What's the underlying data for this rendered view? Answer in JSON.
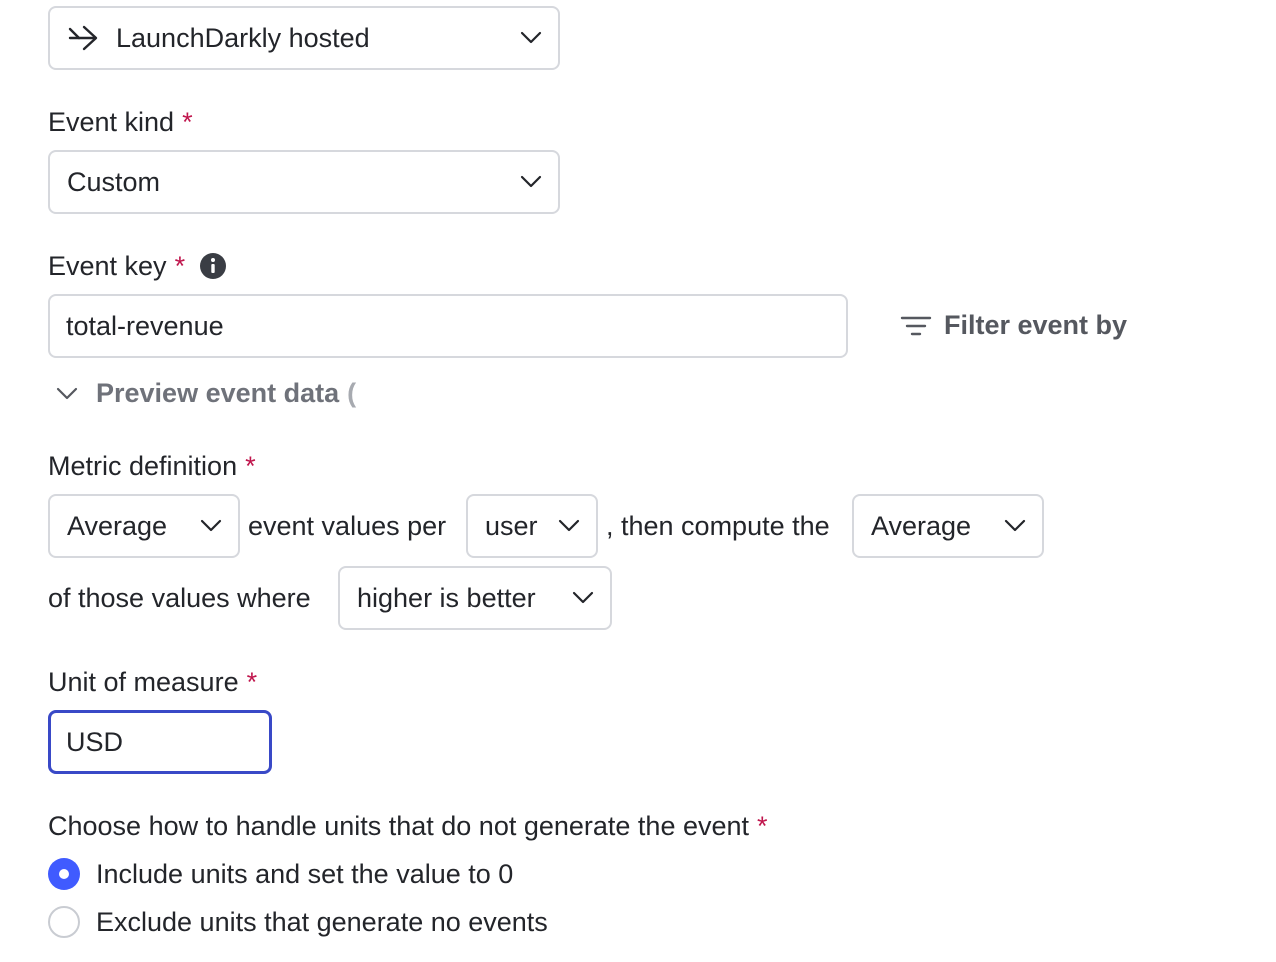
{
  "data_source": {
    "selected": "LaunchDarkly hosted",
    "icon": "arrow-right-icon"
  },
  "event_kind": {
    "label": "Event kind",
    "required_mark": "*",
    "selected": "Custom"
  },
  "event_key": {
    "label": "Event key",
    "required_mark": "*",
    "value": "total-revenue",
    "filter_label": "Filter event by",
    "preview_label": "Preview event data",
    "preview_loading_glyph": "("
  },
  "metric_definition": {
    "label": "Metric definition",
    "required_mark": "*",
    "aggregate_select": "Average",
    "text_1": "event values per",
    "unit_select": "user",
    "text_2": ", then compute the",
    "analysis_select": "Average",
    "text_3": "of those values where",
    "success_select": "higher is better"
  },
  "unit_of_measure": {
    "label": "Unit of measure",
    "required_mark": "*",
    "value": "USD"
  },
  "missing_units": {
    "label": "Choose how to handle units that do not generate the event",
    "required_mark": "*",
    "options": [
      {
        "label": "Include units and set the value to 0",
        "selected": true
      },
      {
        "label": "Exclude units that generate no events",
        "selected": false
      }
    ]
  },
  "colors": {
    "accent": "#405bff",
    "focus_border": "#3949c7",
    "required": "#c0164d",
    "border": "#d6d8dd"
  }
}
